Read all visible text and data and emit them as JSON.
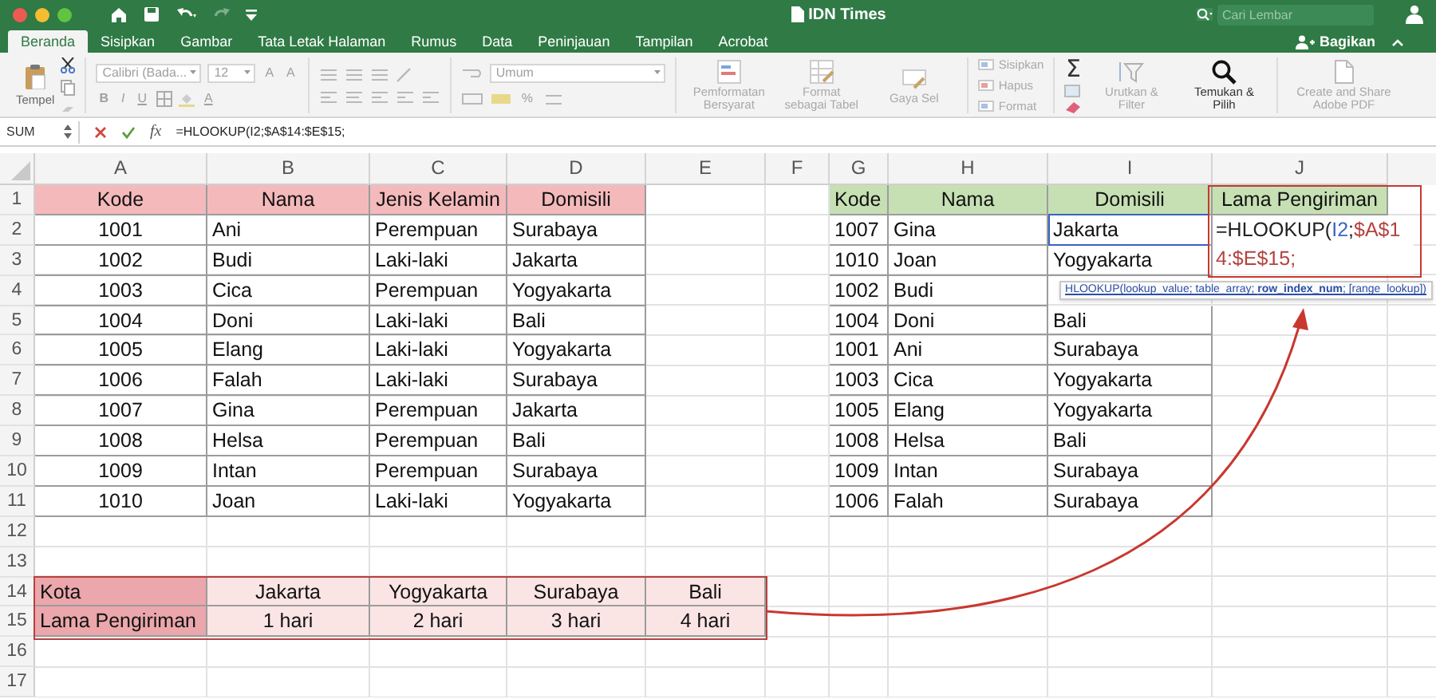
{
  "window": {
    "title": "IDN Times"
  },
  "search": {
    "placeholder": "Cari Lembar"
  },
  "tabs": [
    {
      "label": "Beranda",
      "selected": true
    },
    {
      "label": "Sisipkan",
      "selected": false
    },
    {
      "label": "Gambar",
      "selected": false
    },
    {
      "label": "Tata Letak Halaman",
      "selected": false
    },
    {
      "label": "Rumus",
      "selected": false
    },
    {
      "label": "Data",
      "selected": false
    },
    {
      "label": "Peninjauan",
      "selected": false
    },
    {
      "label": "Tampilan",
      "selected": false
    },
    {
      "label": "Acrobat",
      "selected": false
    }
  ],
  "share_button": "Bagikan",
  "ribbon": {
    "paste_label": "Tempel",
    "font": "Calibri (Bada...",
    "font_size": "12",
    "grow_buttons": [
      "A",
      "A"
    ],
    "style_buttons": [
      "B",
      "I",
      "U"
    ],
    "font_color_button": "A",
    "number_format": "Umum",
    "percent_button": "%",
    "large_buttons": [
      {
        "kind": "conditional",
        "label": "Pemformatan Bersyarat",
        "disabled": true
      },
      {
        "kind": "table",
        "label": "Format sebagai Tabel",
        "disabled": true
      },
      {
        "kind": "styles",
        "label": "Gaya Sel",
        "disabled": true
      }
    ],
    "cell_buttons": [
      {
        "label": "Sisipkan",
        "disabled": true
      },
      {
        "label": "Hapus",
        "disabled": true
      },
      {
        "label": "Format",
        "disabled": true
      }
    ],
    "sum_button": "Σ",
    "edit_buttons": [
      {
        "kind": "sort",
        "label": "Urutkan & Filter",
        "disabled": true
      },
      {
        "kind": "find",
        "label": "Temukan & Pilih",
        "disabled": false
      },
      {
        "kind": "pdf",
        "label": "Create and Share Adobe PDF",
        "disabled": true
      }
    ]
  },
  "formula_bar": {
    "name_box": "SUM",
    "function_label": "fx",
    "formula": "=HLOOKUP(I2;$A$14:$E$15;"
  },
  "sheet": {
    "columns": [
      "A",
      "B",
      "C",
      "D",
      "E",
      "F",
      "G",
      "H",
      "I",
      "J"
    ],
    "rows": [
      {
        "number": "1",
        "cells": [
          {
            "text": "Kode",
            "kind": "head-pink"
          },
          {
            "text": "Nama",
            "kind": "head-pink"
          },
          {
            "text": "Jenis Kelamin",
            "kind": "head-pink"
          },
          {
            "text": "Domisili",
            "kind": "head-pink"
          },
          null,
          null,
          {
            "text": "Kode",
            "kind": "head-green-left"
          },
          {
            "text": "Nama",
            "kind": "head-green"
          },
          {
            "text": "Domisili",
            "kind": "head-green"
          },
          {
            "text": "Lama Pengiriman",
            "kind": "head-green"
          }
        ]
      },
      {
        "number": "2",
        "cells": [
          {
            "text": "1001",
            "kind": "center"
          },
          {
            "text": "Ani",
            "kind": "left"
          },
          {
            "text": "Perempuan",
            "kind": "left"
          },
          {
            "text": "Surabaya",
            "kind": "left"
          },
          null,
          null,
          {
            "text": "1007",
            "kind": "left"
          },
          {
            "text": "Gina",
            "kind": "left"
          },
          {
            "text": "Jakarta",
            "kind": "left"
          }
        ]
      },
      {
        "number": "3",
        "cells": [
          {
            "text": "1002",
            "kind": "center"
          },
          {
            "text": "Budi",
            "kind": "left"
          },
          {
            "text": "Laki-laki",
            "kind": "left"
          },
          {
            "text": "Jakarta",
            "kind": "left"
          },
          null,
          null,
          {
            "text": "1010",
            "kind": "left"
          },
          {
            "text": "Joan",
            "kind": "left"
          },
          {
            "text": "Yogyakarta",
            "kind": "left"
          }
        ]
      },
      {
        "number": "4",
        "cells": [
          {
            "text": "1003",
            "kind": "center"
          },
          {
            "text": "Cica",
            "kind": "left"
          },
          {
            "text": "Perempuan",
            "kind": "left"
          },
          {
            "text": "Yogyakarta",
            "kind": "left"
          },
          null,
          null,
          {
            "text": "1002",
            "kind": "left"
          },
          {
            "text": "Budi",
            "kind": "left"
          }
        ]
      },
      {
        "number": "5",
        "cells": [
          {
            "text": "1004",
            "kind": "center"
          },
          {
            "text": "Doni",
            "kind": "left"
          },
          {
            "text": "Laki-laki",
            "kind": "left"
          },
          {
            "text": "Bali",
            "kind": "left"
          },
          null,
          null,
          {
            "text": "1004",
            "kind": "left"
          },
          {
            "text": "Doni",
            "kind": "left"
          },
          {
            "text": "Bali",
            "kind": "left"
          }
        ]
      },
      {
        "number": "6",
        "cells": [
          {
            "text": "1005",
            "kind": "center"
          },
          {
            "text": "Elang",
            "kind": "left"
          },
          {
            "text": "Laki-laki",
            "kind": "left"
          },
          {
            "text": "Yogyakarta",
            "kind": "left"
          },
          null,
          null,
          {
            "text": "1001",
            "kind": "left"
          },
          {
            "text": "Ani",
            "kind": "left"
          },
          {
            "text": "Surabaya",
            "kind": "left"
          }
        ]
      },
      {
        "number": "7",
        "cells": [
          {
            "text": "1006",
            "kind": "center"
          },
          {
            "text": "Falah",
            "kind": "left"
          },
          {
            "text": "Laki-laki",
            "kind": "left"
          },
          {
            "text": "Surabaya",
            "kind": "left"
          },
          null,
          null,
          {
            "text": "1003",
            "kind": "left"
          },
          {
            "text": "Cica",
            "kind": "left"
          },
          {
            "text": "Yogyakarta",
            "kind": "left"
          }
        ]
      },
      {
        "number": "8",
        "cells": [
          {
            "text": "1007",
            "kind": "center"
          },
          {
            "text": "Gina",
            "kind": "left"
          },
          {
            "text": "Perempuan",
            "kind": "left"
          },
          {
            "text": "Jakarta",
            "kind": "left"
          },
          null,
          null,
          {
            "text": "1005",
            "kind": "left"
          },
          {
            "text": "Elang",
            "kind": "left"
          },
          {
            "text": "Yogyakarta",
            "kind": "left"
          }
        ]
      },
      {
        "number": "9",
        "cells": [
          {
            "text": "1008",
            "kind": "center"
          },
          {
            "text": "Helsa",
            "kind": "left"
          },
          {
            "text": "Perempuan",
            "kind": "left"
          },
          {
            "text": "Bali",
            "kind": "left"
          },
          null,
          null,
          {
            "text": "1008",
            "kind": "left"
          },
          {
            "text": "Helsa",
            "kind": "left"
          },
          {
            "text": "Bali",
            "kind": "left"
          }
        ]
      },
      {
        "number": "10",
        "cells": [
          {
            "text": "1009",
            "kind": "center"
          },
          {
            "text": "Intan",
            "kind": "left"
          },
          {
            "text": "Perempuan",
            "kind": "left"
          },
          {
            "text": "Surabaya",
            "kind": "left"
          },
          null,
          null,
          {
            "text": "1009",
            "kind": "left"
          },
          {
            "text": "Intan",
            "kind": "left"
          },
          {
            "text": "Surabaya",
            "kind": "left"
          }
        ]
      },
      {
        "number": "11",
        "cells": [
          {
            "text": "1010",
            "kind": "center"
          },
          {
            "text": "Joan",
            "kind": "left"
          },
          {
            "text": "Laki-laki",
            "kind": "left"
          },
          {
            "text": "Yogyakarta",
            "kind": "left"
          },
          null,
          null,
          {
            "text": "1006",
            "kind": "left"
          },
          {
            "text": "Falah",
            "kind": "left"
          },
          {
            "text": "Surabaya",
            "kind": "left"
          }
        ]
      },
      {
        "number": "12"
      },
      {
        "number": "13"
      },
      {
        "number": "14",
        "cells": [
          {
            "text": "Kota",
            "kind": "label-dark"
          },
          {
            "text": "Jakarta",
            "kind": "value-light"
          },
          {
            "text": "Yogyakarta",
            "kind": "value-light"
          },
          {
            "text": "Surabaya",
            "kind": "value-light"
          },
          {
            "text": "Bali",
            "kind": "value-light"
          }
        ]
      },
      {
        "number": "15",
        "cells": [
          {
            "text": "Lama Pengiriman",
            "kind": "label-dark"
          },
          {
            "text": "1 hari",
            "kind": "value-light"
          },
          {
            "text": "2 hari",
            "kind": "value-light"
          },
          {
            "text": "3 hari",
            "kind": "value-light"
          },
          {
            "text": "4 hari",
            "kind": "value-light"
          }
        ]
      },
      {
        "number": "16"
      },
      {
        "number": "17"
      }
    ],
    "editor": {
      "parts": [
        {
          "text": "=HLOOKUP(",
          "color": "#222222"
        },
        {
          "text": "I2",
          "color": "#3a62c4"
        },
        {
          "text": ";",
          "color": "#222222"
        },
        {
          "text": "$A$14:$E$15",
          "color": "#b4423f"
        },
        {
          "text": ";",
          "color": "#b4423f"
        }
      ]
    },
    "tooltip": "HLOOKUP(lookup_value; table_array; **row_index_num**; [range_lookup])"
  }
}
